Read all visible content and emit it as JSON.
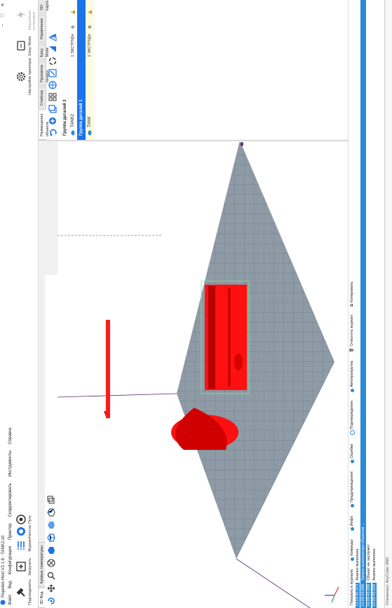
{
  "window": {
    "title": "Repetier-Host V2.1.6 - TANK2.stl",
    "controls": [
      "–",
      "□",
      "✕"
    ]
  },
  "menu": [
    "Файл",
    "Вид",
    "Конфигурация",
    "Принтер",
    "Скорректировать",
    "Инструменты",
    "Справка"
  ],
  "toolbar": {
    "left": [
      {
        "label": "Подсоединить",
        "icon": "plug-icon"
      },
      {
        "label": "Загрузить",
        "icon": "load-icon"
      },
      {
        "label": "Журнал",
        "icon": "log-icon"
      },
      {
        "label": "Чистое",
        "icon": "clean-icon"
      },
      {
        "label": "Путь",
        "icon": "path-icon"
      }
    ],
    "right": [
      {
        "label": "Настройки принтера",
        "icon": "gear-icon"
      },
      {
        "label": "Easy Mode",
        "icon": "easymode-icon"
      },
      {
        "label": "Аварийная остановка",
        "icon": "emergency-icon"
      }
    ]
  },
  "left_tabs": [
    "3D Вид",
    "Кривые температуры"
  ],
  "right_tabs": [
    "Размещение объекта",
    "Слайсер",
    "Просмотр печати",
    "Easy Mode",
    "Управление",
    "SD-карта"
  ],
  "object_panel": {
    "group2": "Группа деталей 2",
    "group1": "Группа деталей 1",
    "rows": [
      {
        "name": "TANK2",
        "count": "1 ЭКСТРУД",
        "selected": false
      },
      {
        "name": "TANK",
        "count": "1 ЭКСТРУД",
        "selected": false
      }
    ]
  },
  "filters": [
    "Показать в журнале",
    "Команды",
    "Инфо",
    "Предупреждения",
    "Ошибки",
    "Подтверждение",
    "Автопрокрутка",
    "Очистить журнал",
    "Копировать"
  ],
  "log": [
    {
      "time": "13:59:45.373",
      "text": "Анализ выполнен.",
      "hl": false
    },
    {
      "time": "14:09:43.898",
      "text": "Запуск анализатора объектов ...",
      "hl": true
    },
    {
      "time": "14:09:43.898",
      "text": "Объект не заслужит",
      "hl": false
    },
    {
      "time": "14:09:43.929",
      "text": "Анализ выполнен.",
      "hl": false
    }
  ],
  "status": "Отключено: AnyCubic i3M2",
  "colors": {
    "accent": "#1a73e8",
    "model": "#ff1010",
    "bed": "#8e9ba6"
  }
}
